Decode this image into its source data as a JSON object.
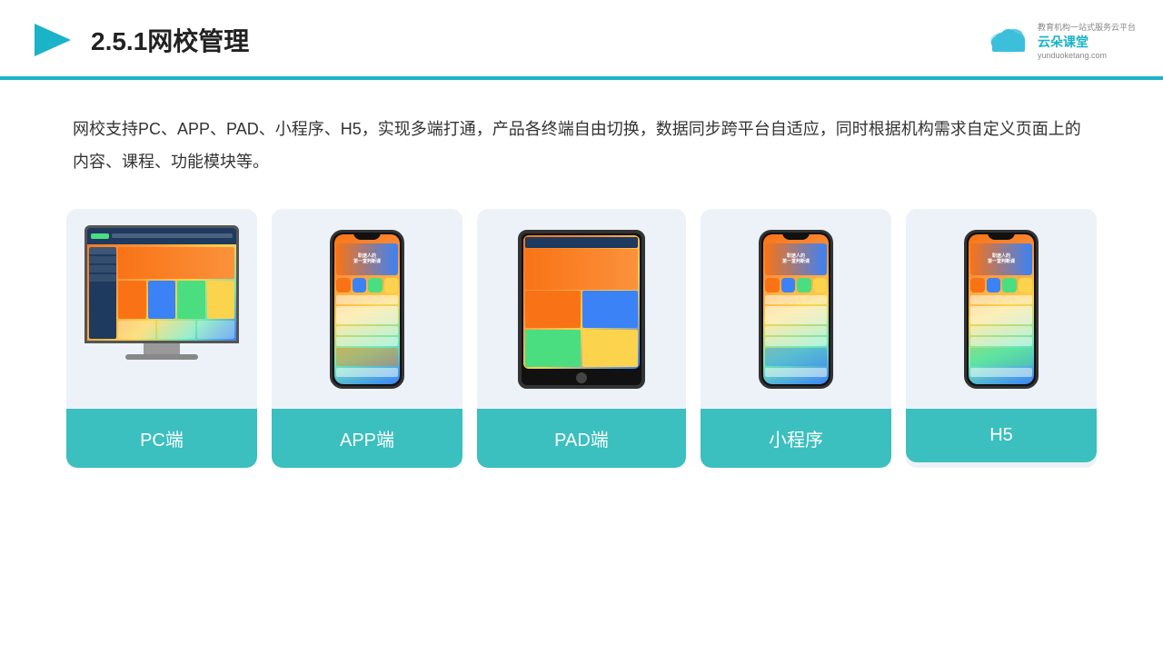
{
  "header": {
    "title": "2.5.1网校管理",
    "brand": {
      "name": "云朵课堂",
      "url": "yunduoketang.com",
      "tagline": "教育机构一站式服务云平台"
    }
  },
  "description": {
    "text": "网校支持PC、APP、PAD、小程序、H5，实现多端打通，产品各终端自由切换，数据同步跨平台自适应，同时根据机构需求自定义页面上的内容、课程、功能模块等。"
  },
  "cards": [
    {
      "label": "PC端",
      "type": "pc"
    },
    {
      "label": "APP端",
      "type": "phone"
    },
    {
      "label": "PAD端",
      "type": "tablet"
    },
    {
      "label": "小程序",
      "type": "phone2"
    },
    {
      "label": "H5",
      "type": "phone3"
    }
  ],
  "colors": {
    "accent": "#1ab3c8",
    "card_bg": "#ecf2f8",
    "card_label": "#3bbfbf"
  }
}
